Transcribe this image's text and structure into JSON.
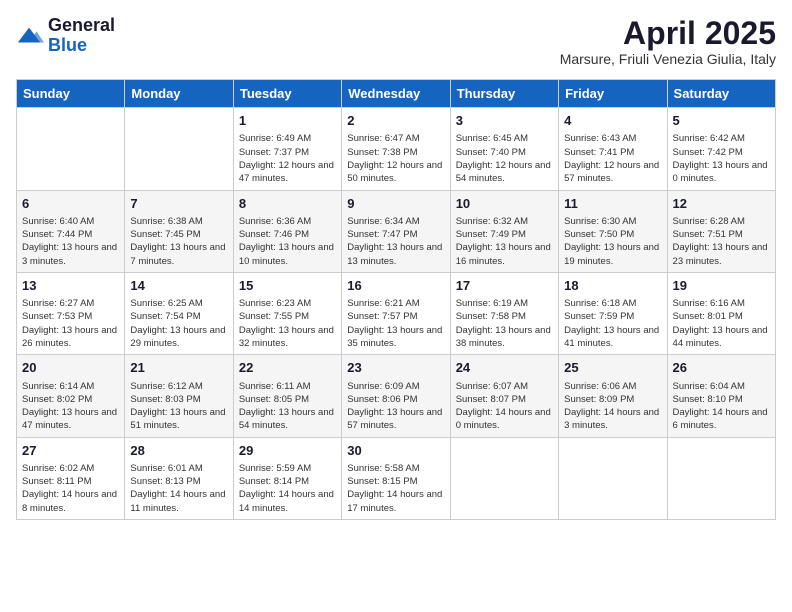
{
  "logo": {
    "line1": "General",
    "line2": "Blue",
    "icon_color": "#1565c0"
  },
  "header": {
    "title": "April 2025",
    "subtitle": "Marsure, Friuli Venezia Giulia, Italy"
  },
  "days_of_week": [
    "Sunday",
    "Monday",
    "Tuesday",
    "Wednesday",
    "Thursday",
    "Friday",
    "Saturday"
  ],
  "weeks": [
    [
      {
        "num": "",
        "info": ""
      },
      {
        "num": "",
        "info": ""
      },
      {
        "num": "1",
        "info": "Sunrise: 6:49 AM\nSunset: 7:37 PM\nDaylight: 12 hours and 47 minutes."
      },
      {
        "num": "2",
        "info": "Sunrise: 6:47 AM\nSunset: 7:38 PM\nDaylight: 12 hours and 50 minutes."
      },
      {
        "num": "3",
        "info": "Sunrise: 6:45 AM\nSunset: 7:40 PM\nDaylight: 12 hours and 54 minutes."
      },
      {
        "num": "4",
        "info": "Sunrise: 6:43 AM\nSunset: 7:41 PM\nDaylight: 12 hours and 57 minutes."
      },
      {
        "num": "5",
        "info": "Sunrise: 6:42 AM\nSunset: 7:42 PM\nDaylight: 13 hours and 0 minutes."
      }
    ],
    [
      {
        "num": "6",
        "info": "Sunrise: 6:40 AM\nSunset: 7:44 PM\nDaylight: 13 hours and 3 minutes."
      },
      {
        "num": "7",
        "info": "Sunrise: 6:38 AM\nSunset: 7:45 PM\nDaylight: 13 hours and 7 minutes."
      },
      {
        "num": "8",
        "info": "Sunrise: 6:36 AM\nSunset: 7:46 PM\nDaylight: 13 hours and 10 minutes."
      },
      {
        "num": "9",
        "info": "Sunrise: 6:34 AM\nSunset: 7:47 PM\nDaylight: 13 hours and 13 minutes."
      },
      {
        "num": "10",
        "info": "Sunrise: 6:32 AM\nSunset: 7:49 PM\nDaylight: 13 hours and 16 minutes."
      },
      {
        "num": "11",
        "info": "Sunrise: 6:30 AM\nSunset: 7:50 PM\nDaylight: 13 hours and 19 minutes."
      },
      {
        "num": "12",
        "info": "Sunrise: 6:28 AM\nSunset: 7:51 PM\nDaylight: 13 hours and 23 minutes."
      }
    ],
    [
      {
        "num": "13",
        "info": "Sunrise: 6:27 AM\nSunset: 7:53 PM\nDaylight: 13 hours and 26 minutes."
      },
      {
        "num": "14",
        "info": "Sunrise: 6:25 AM\nSunset: 7:54 PM\nDaylight: 13 hours and 29 minutes."
      },
      {
        "num": "15",
        "info": "Sunrise: 6:23 AM\nSunset: 7:55 PM\nDaylight: 13 hours and 32 minutes."
      },
      {
        "num": "16",
        "info": "Sunrise: 6:21 AM\nSunset: 7:57 PM\nDaylight: 13 hours and 35 minutes."
      },
      {
        "num": "17",
        "info": "Sunrise: 6:19 AM\nSunset: 7:58 PM\nDaylight: 13 hours and 38 minutes."
      },
      {
        "num": "18",
        "info": "Sunrise: 6:18 AM\nSunset: 7:59 PM\nDaylight: 13 hours and 41 minutes."
      },
      {
        "num": "19",
        "info": "Sunrise: 6:16 AM\nSunset: 8:01 PM\nDaylight: 13 hours and 44 minutes."
      }
    ],
    [
      {
        "num": "20",
        "info": "Sunrise: 6:14 AM\nSunset: 8:02 PM\nDaylight: 13 hours and 47 minutes."
      },
      {
        "num": "21",
        "info": "Sunrise: 6:12 AM\nSunset: 8:03 PM\nDaylight: 13 hours and 51 minutes."
      },
      {
        "num": "22",
        "info": "Sunrise: 6:11 AM\nSunset: 8:05 PM\nDaylight: 13 hours and 54 minutes."
      },
      {
        "num": "23",
        "info": "Sunrise: 6:09 AM\nSunset: 8:06 PM\nDaylight: 13 hours and 57 minutes."
      },
      {
        "num": "24",
        "info": "Sunrise: 6:07 AM\nSunset: 8:07 PM\nDaylight: 14 hours and 0 minutes."
      },
      {
        "num": "25",
        "info": "Sunrise: 6:06 AM\nSunset: 8:09 PM\nDaylight: 14 hours and 3 minutes."
      },
      {
        "num": "26",
        "info": "Sunrise: 6:04 AM\nSunset: 8:10 PM\nDaylight: 14 hours and 6 minutes."
      }
    ],
    [
      {
        "num": "27",
        "info": "Sunrise: 6:02 AM\nSunset: 8:11 PM\nDaylight: 14 hours and 8 minutes."
      },
      {
        "num": "28",
        "info": "Sunrise: 6:01 AM\nSunset: 8:13 PM\nDaylight: 14 hours and 11 minutes."
      },
      {
        "num": "29",
        "info": "Sunrise: 5:59 AM\nSunset: 8:14 PM\nDaylight: 14 hours and 14 minutes."
      },
      {
        "num": "30",
        "info": "Sunrise: 5:58 AM\nSunset: 8:15 PM\nDaylight: 14 hours and 17 minutes."
      },
      {
        "num": "",
        "info": ""
      },
      {
        "num": "",
        "info": ""
      },
      {
        "num": "",
        "info": ""
      }
    ]
  ]
}
